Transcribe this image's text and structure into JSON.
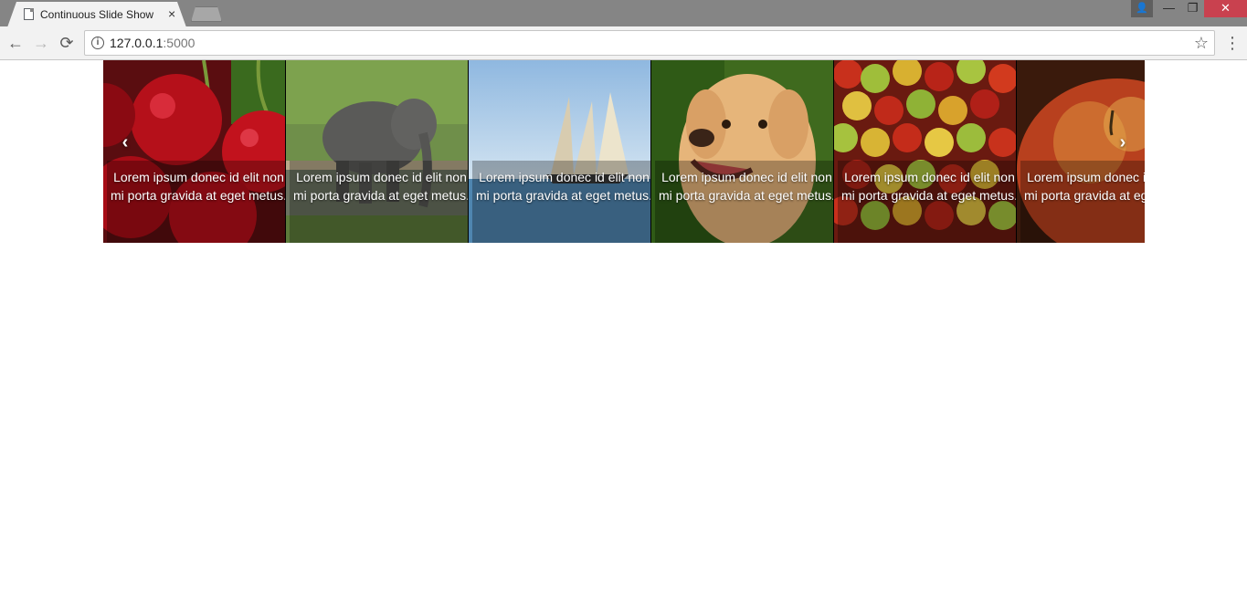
{
  "browser": {
    "tab_title": "Continuous Slide Show",
    "tab_close": "×",
    "url_host": "127.0.0.1",
    "url_port": ":5000",
    "user_icon": "👤",
    "min_label": "—",
    "max_label": "❐",
    "close_label": "✕",
    "back_icon": "←",
    "forward_icon": "→",
    "reload_icon": "⟳",
    "info_icon": "i",
    "star_icon": "☆",
    "menu_icon": "⋮"
  },
  "slideshow": {
    "prev_label": "‹",
    "next_label": "›",
    "slides": [
      {
        "subject": "cherries",
        "caption": "Lorem ipsum donec id elit non mi porta gravida at eget metus."
      },
      {
        "subject": "elephant",
        "caption": "Lorem ipsum donec id elit non mi porta gravida at eget metus."
      },
      {
        "subject": "sailboat",
        "caption": "Lorem ipsum donec id elit non mi porta gravida at eget metus."
      },
      {
        "subject": "dog",
        "caption": "Lorem ipsum donec id elit non mi porta gravida at eget metus."
      },
      {
        "subject": "apples",
        "caption": "Lorem ipsum donec id elit non mi porta gravida at eget metus."
      },
      {
        "subject": "apple",
        "caption": "Lorem ipsum donec id elit non mi porta gravida at eget metus."
      }
    ]
  }
}
